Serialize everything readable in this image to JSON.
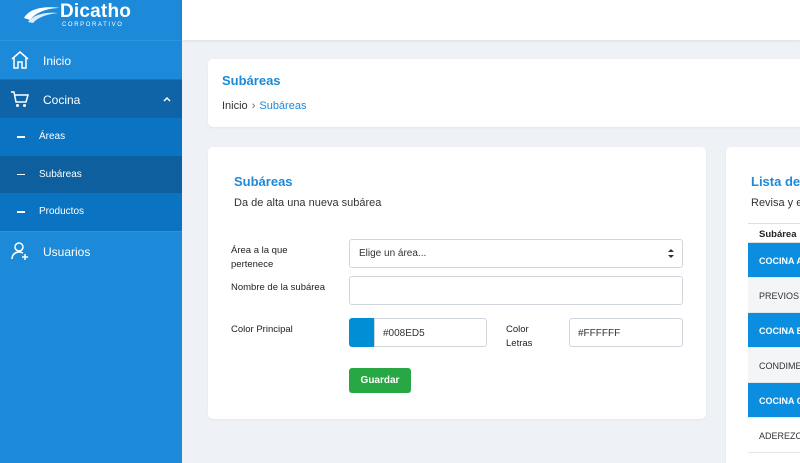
{
  "brand": {
    "name": "Dicatho",
    "tagline": "CORPORATIVO"
  },
  "sidebar": {
    "items": [
      {
        "label": "Inicio",
        "icon": "home-icon"
      },
      {
        "label": "Cocina",
        "icon": "cart-icon"
      },
      {
        "label": "Usuarios",
        "icon": "user-add-icon"
      }
    ],
    "cocina_sub": [
      {
        "label": "Áreas"
      },
      {
        "label": "Subáreas"
      },
      {
        "label": "Productos"
      }
    ]
  },
  "breadcrumb": {
    "title": "Subáreas",
    "home": "Inicio",
    "separator": "›",
    "current": "Subáreas"
  },
  "form": {
    "title": "Subáreas",
    "subtitle": "Da de alta una nueva subárea",
    "area_label_1": "Área a la que",
    "area_label_2": "pertenece",
    "area_placeholder": "Elige un área...",
    "name_label": "Nombre de la subárea",
    "name_value": "",
    "color_label": "Color Principal",
    "color_value": "#008ED5",
    "letras_label_1": "Color",
    "letras_label_2": "Letras",
    "letras_value": "#FFFFFF",
    "save_label": "Guardar"
  },
  "list": {
    "title": "Lista de",
    "subtitle": "Revisa y e",
    "header": "Subárea",
    "rows": [
      {
        "text": "COCINA A",
        "style": "blue"
      },
      {
        "text": "PREVIOS",
        "style": "grey"
      },
      {
        "text": "COCINA B",
        "style": "blue"
      },
      {
        "text": "CONDIME",
        "style": "grey"
      },
      {
        "text": "COCINA C",
        "style": "blue"
      },
      {
        "text": "ADEREZO",
        "style": "white"
      }
    ]
  },
  "colors": {
    "accent": "#1c8ad9",
    "sidebar": "#1c8ad9",
    "save": "#28a745",
    "swatch": "#008ED5"
  }
}
